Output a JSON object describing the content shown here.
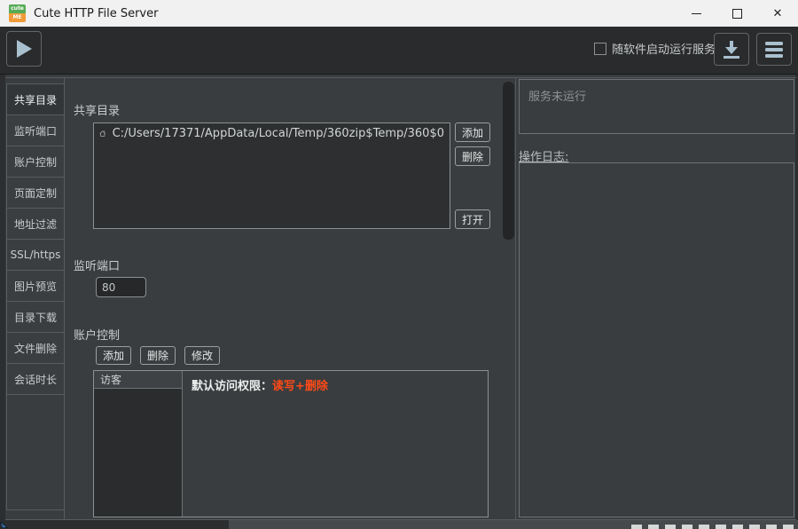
{
  "window": {
    "title": "Cute HTTP File Server",
    "app_icon_top": "cute",
    "app_icon_bottom": "ME"
  },
  "toolbar": {
    "autostart_checkbox_label": "随软件启动运行服务",
    "autostart_checked": false
  },
  "sidebar": {
    "active_tab": "共享目录",
    "tabs": [
      {
        "label": "共享目录"
      },
      {
        "label": "监听端口"
      },
      {
        "label": "账户控制"
      },
      {
        "label": "页面定制"
      },
      {
        "label": "地址过滤"
      },
      {
        "label": "SSL/https"
      },
      {
        "label": "图片预览"
      },
      {
        "label": "目录下载"
      },
      {
        "label": "文件删除"
      },
      {
        "label": "会话时长"
      }
    ]
  },
  "content": {
    "share": {
      "label": "共享目录",
      "path": "C:/Users/17371/AppData/Local/Temp/360zip$Temp/360$0",
      "add_button": "添加",
      "delete_button": "删除",
      "open_button": "打开"
    },
    "port": {
      "label": "监听端口",
      "value": "80"
    },
    "account": {
      "label": "账户控制",
      "add_button": "添加",
      "delete_button": "删除",
      "modify_button": "修改",
      "column_header": "访客",
      "permission_label": "默认访问权限：",
      "permission_value": "读写+删除"
    }
  },
  "right_panel": {
    "status": "服务未运行",
    "log_label": "操作日志:"
  },
  "colors": {
    "accent_orange": "#ff4a17",
    "icon_blue": "#a9c0ce",
    "toolbar_bg": "#292b2c",
    "panel_bg": "#3a3d3f",
    "titlebar_bg": "#f1f1f2"
  }
}
